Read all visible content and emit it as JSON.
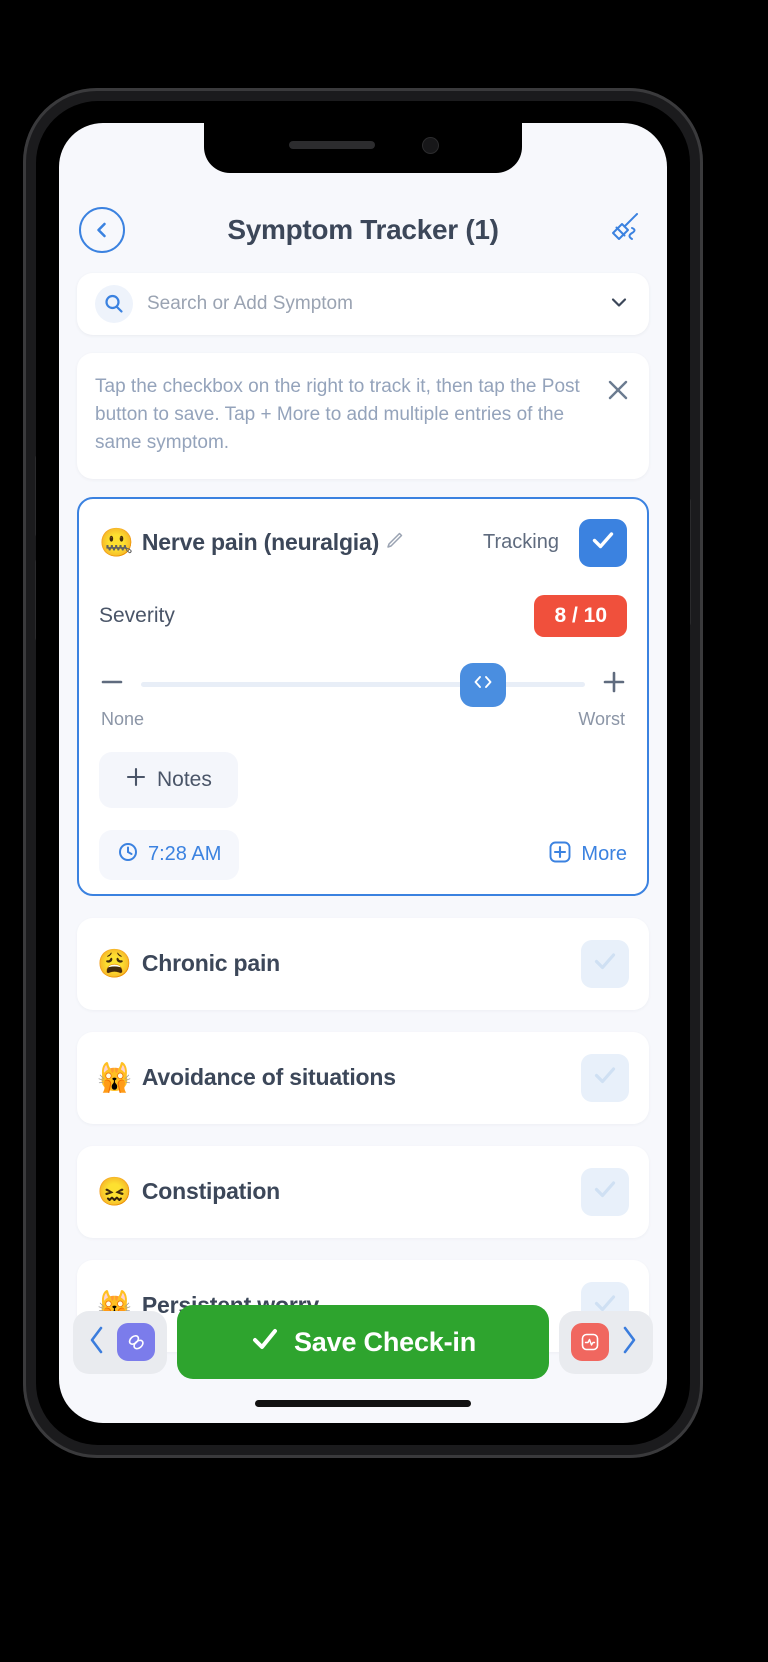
{
  "header": {
    "title": "Symptom Tracker (1)",
    "back_icon": "chevron-left-icon",
    "broom_icon": "broom-icon"
  },
  "search": {
    "placeholder": "Search or Add Symptom",
    "value": "",
    "icon": "search-icon",
    "dropdown_icon": "chevron-down-icon"
  },
  "info_banner": {
    "text": "Tap the checkbox on the right to track it, then tap the Post button to save. Tap + More to add multiple entries of the same symptom.",
    "close_icon": "close-icon"
  },
  "active_symptom": {
    "emoji": "🤐",
    "emoji_name": "zipper-mouth-face-emoji",
    "name": "Nerve pain (neuralgia)",
    "edit_icon": "pencil-icon",
    "tracking_label": "Tracking",
    "checked": true,
    "severity_label": "Severity",
    "severity_value": "8 / 10",
    "severity_number": 8,
    "severity_max": 10,
    "severity_percent": 77,
    "slider_min_label": "None",
    "slider_max_label": "Worst",
    "minus_icon": "minus-icon",
    "plus_icon": "plus-icon",
    "thumb_icon": "left-right-arrows-icon",
    "notes_label": "Notes",
    "notes_plus_icon": "plus-icon",
    "time": "7:28 AM",
    "time_icon": "clock-icon",
    "more_label": "More",
    "more_icon": "plus-circle-icon",
    "accent_color": "#3b82e0",
    "severity_badge_color": "#f0503c"
  },
  "symptom_list": [
    {
      "emoji": "😩",
      "emoji_name": "weary-face-emoji",
      "name": "Chronic pain",
      "checked": false
    },
    {
      "emoji": "🙀",
      "emoji_name": "weary-cat-face-emoji",
      "name": "Avoidance of situations",
      "checked": false
    },
    {
      "emoji": "😖",
      "emoji_name": "confounded-face-emoji",
      "name": "Constipation",
      "checked": false
    },
    {
      "emoji": "🙀",
      "emoji_name": "weary-cat-face-emoji",
      "name": "Persistent worry",
      "checked": false
    }
  ],
  "bottom_bar": {
    "prev_icon": "chevron-left-icon",
    "prev_mini_icon": "pills-icon",
    "save_label": "Save Check-in",
    "save_check_icon": "check-icon",
    "save_color": "#2ea42e",
    "next_mini_icon": "vitals-icon",
    "next_icon": "chevron-right-icon"
  }
}
